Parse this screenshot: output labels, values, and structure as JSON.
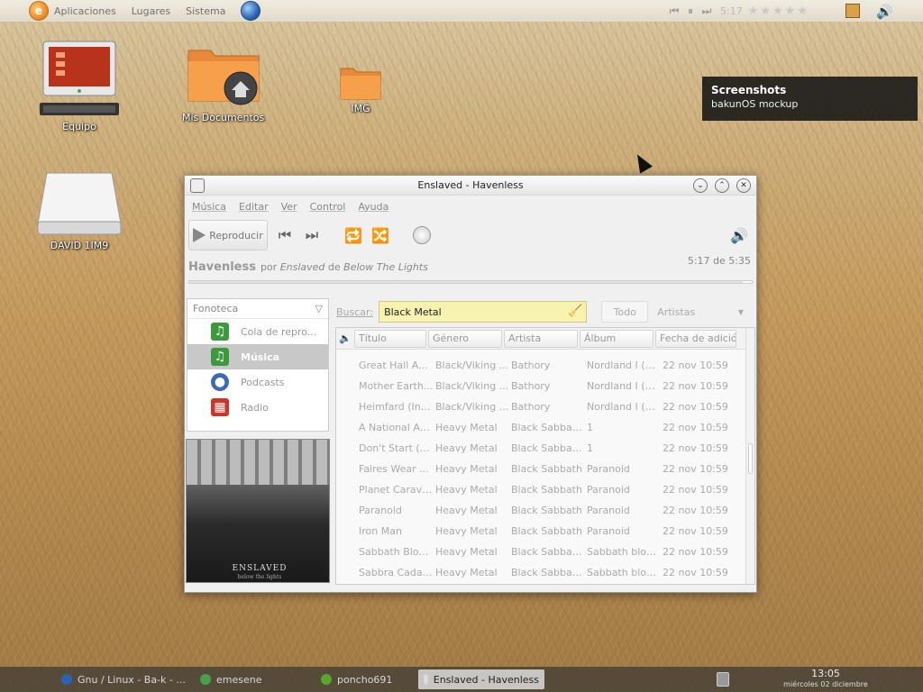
{
  "top_panel": {
    "menus": [
      "Aplicaciones",
      "Lugares",
      "Sistema"
    ],
    "time": "5:17",
    "stars": "★★★★★"
  },
  "desktop": {
    "icons": [
      {
        "label": "Equipo",
        "icon": "computer-icon"
      },
      {
        "label": "Mis Documentos",
        "icon": "home-folder-icon"
      },
      {
        "label": "IMG",
        "icon": "folder-icon"
      },
      {
        "label": "DAVID 1IM9",
        "icon": "drive-icon"
      }
    ]
  },
  "notification": {
    "title": "Screenshots",
    "body": "bakunOS mockup"
  },
  "window": {
    "title": "Enslaved - Havenless",
    "menu": [
      "Música",
      "Editar",
      "Ver",
      "Control",
      "Ayuda"
    ],
    "toolbar": {
      "play_label": "Reproducir"
    },
    "now_playing": {
      "song": "Havenless",
      "by": "por",
      "artist": "Enslaved",
      "of": "de",
      "album": "Below The Lights",
      "position": "5:17 de 5:35",
      "progress": 0.984
    },
    "library": {
      "header": "Fonoteca",
      "sources": [
        {
          "label": "Cola de repro...",
          "icon": "queue-icon",
          "selected": false
        },
        {
          "label": "Música",
          "icon": "music-note-icon",
          "selected": true
        },
        {
          "label": "Podcasts",
          "icon": "podcast-icon",
          "selected": false
        },
        {
          "label": "Radio",
          "icon": "radio-icon",
          "selected": false
        }
      ]
    },
    "album_art": {
      "band": "ENSLAVED",
      "subtitle": "below the lights"
    },
    "search": {
      "label": "Buscar:",
      "value": "Black Metal",
      "filter_all": "Todo",
      "filter_select": "Artistas"
    },
    "table": {
      "columns": [
        "Título",
        "Género",
        "Artista",
        "Álbum",
        "Fecha de adición"
      ],
      "rows": [
        [
          "Great Hall A...",
          "Black/Viking ...",
          "Bathory",
          "Nordland I (2...",
          "22 nov 10:59"
        ],
        [
          "Mother Earth...",
          "Black/Viking ...",
          "Bathory",
          "Nordland I (2...",
          "22 nov 10:59"
        ],
        [
          "Heimfard (In...",
          "Black/Viking ...",
          "Bathory",
          "Nordland I (2...",
          "22 nov 10:59"
        ],
        [
          "A National Ac...",
          "Heavy Metal",
          "Black Sabbath.",
          "1",
          "22 nov 10:59"
        ],
        [
          "Don't Start (T...",
          "Heavy Metal",
          "Black Sabbath.",
          "1",
          "22 nov 10:59"
        ],
        [
          "Faires Wear ...",
          "Heavy Metal",
          "Black Sabbath",
          "Paranoid",
          "22 nov 10:59"
        ],
        [
          "Planet Caravan",
          "Heavy Metal",
          "Black Sabbath",
          "Paranoid",
          "22 nov 10:59"
        ],
        [
          "Paranoid",
          "Heavy Metal",
          "Black Sabbath",
          "Paranoid",
          "22 nov 10:59"
        ],
        [
          "Iron Man",
          "Heavy Metal",
          "Black Sabbath",
          "Paranoid",
          "22 nov 10:59"
        ],
        [
          "Sabbath Bloo...",
          "Heavy Metal",
          "Black Sabbath.",
          "Sabbath bloo...",
          "22 nov 10:59"
        ],
        [
          "Sabbra Cada...",
          "Heavy Metal",
          "Black Sabbath.",
          "Sabbath bloo...",
          "22 nov 10:59"
        ]
      ]
    }
  },
  "taskbar": {
    "tasks": [
      {
        "label": "Gnu / Linux - Ba-k - ...",
        "icon": "browser-icon",
        "active": false
      },
      {
        "label": "emesene",
        "icon": "emesene-icon",
        "active": false
      },
      {
        "label": "poncho691",
        "icon": "user-status-icon",
        "active": false
      },
      {
        "label": "Enslaved - Havenless",
        "icon": "music-player-icon",
        "active": true
      }
    ],
    "clock_time": "13:05",
    "clock_date": "miércoles 02 diciembre"
  },
  "colors": {
    "search_bg": "#f7f2b0",
    "selected_source": "#c8c8c8",
    "notification_bg": "#141414"
  }
}
